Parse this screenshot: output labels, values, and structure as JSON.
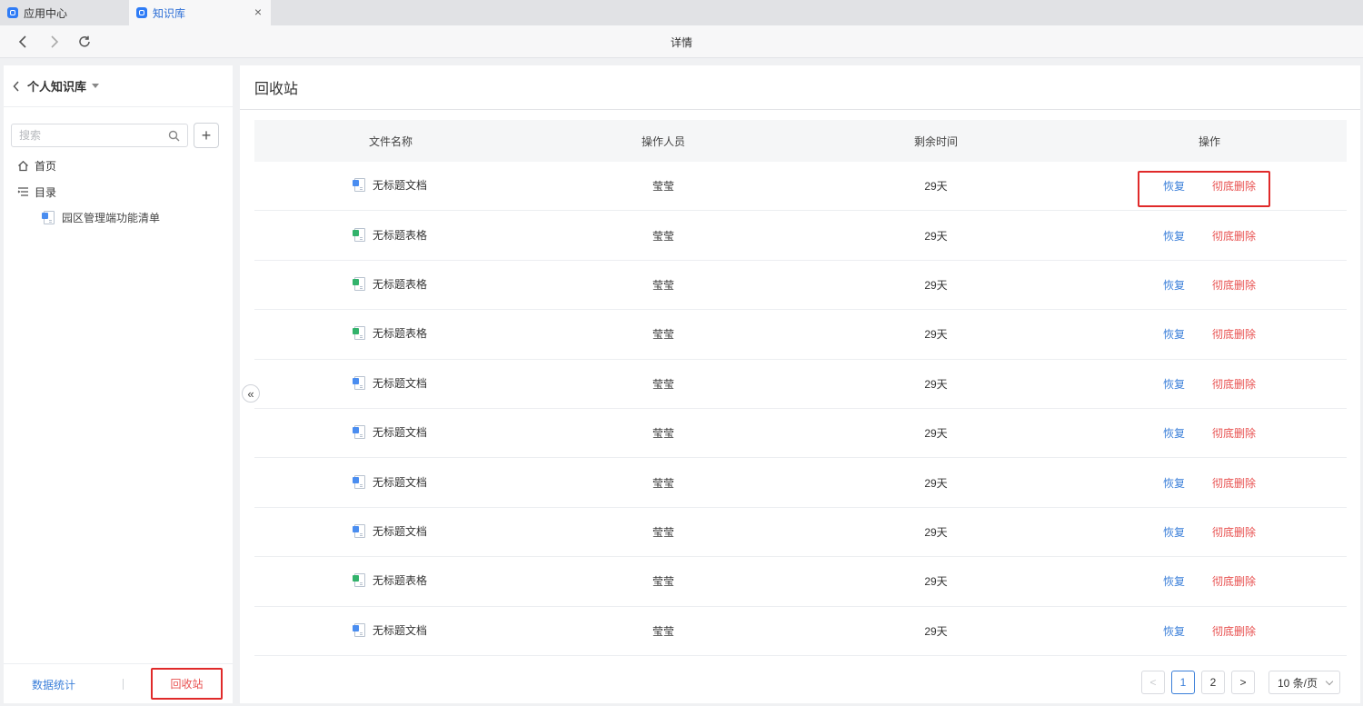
{
  "tabs": [
    {
      "label": "应用中心",
      "active": false
    },
    {
      "label": "知识库",
      "active": true
    }
  ],
  "navbar": {
    "title": "详情"
  },
  "sidebar": {
    "kb_title": "个人知识库",
    "search_placeholder": "搜索",
    "nav": [
      {
        "label": "首页",
        "icon": "home-icon"
      },
      {
        "label": "目录",
        "icon": "list-icon"
      }
    ],
    "tree": [
      {
        "label": "园区管理端功能清单",
        "icon": "document-icon"
      }
    ],
    "footer": {
      "stats_label": "数据统计",
      "recycle_label": "回收站"
    }
  },
  "main": {
    "title": "回收站",
    "columns": [
      "文件名称",
      "操作人员",
      "剩余时间",
      "操作"
    ],
    "rows": [
      {
        "name": "无标题文档",
        "type": "doc",
        "operator": "莹莹",
        "remaining": "29天"
      },
      {
        "name": "无标题表格",
        "type": "sheet",
        "operator": "莹莹",
        "remaining": "29天"
      },
      {
        "name": "无标题表格",
        "type": "sheet",
        "operator": "莹莹",
        "remaining": "29天"
      },
      {
        "name": "无标题表格",
        "type": "sheet",
        "operator": "莹莹",
        "remaining": "29天"
      },
      {
        "name": "无标题文档",
        "type": "doc",
        "operator": "莹莹",
        "remaining": "29天"
      },
      {
        "name": "无标题文档",
        "type": "doc",
        "operator": "莹莹",
        "remaining": "29天"
      },
      {
        "name": "无标题文档",
        "type": "doc",
        "operator": "莹莹",
        "remaining": "29天"
      },
      {
        "name": "无标题文档",
        "type": "doc",
        "operator": "莹莹",
        "remaining": "29天"
      },
      {
        "name": "无标题表格",
        "type": "sheet",
        "operator": "莹莹",
        "remaining": "29天"
      },
      {
        "name": "无标题文档",
        "type": "doc",
        "operator": "莹莹",
        "remaining": "29天"
      }
    ],
    "actions": {
      "restore": "恢复",
      "delete": "彻底删除"
    },
    "pagination": {
      "pages": [
        "1",
        "2"
      ],
      "current": "1",
      "page_size": "10 条/页",
      "prev": "<",
      "next": ">"
    }
  },
  "colors": {
    "accent": "#3b7fd9",
    "danger": "#e8504f",
    "highlight": "#e02a2a",
    "doc_badge": "#4a8df0",
    "sheet_badge": "#32b26b"
  }
}
